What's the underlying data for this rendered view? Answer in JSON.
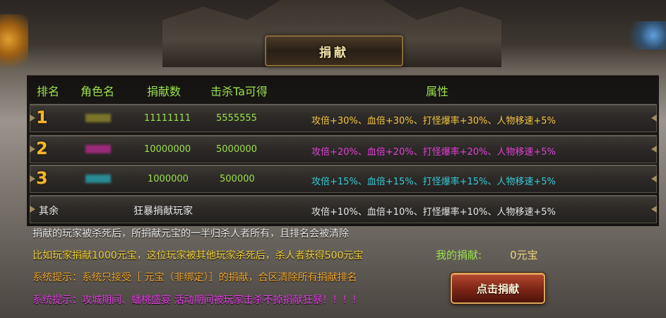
{
  "title": "捐献",
  "colors": {
    "header_green": "#9be04c",
    "rank1_attr": "#f2c340",
    "rank2_attr": "#e43fd6",
    "rank3_attr": "#36c9d6",
    "other_attr": "#e6e6e6",
    "rank1_name_blur": "#7a7428",
    "rank2_name_blur": "#9c2a7a",
    "rank3_name_blur": "#2a8a94"
  },
  "table": {
    "headers": {
      "rank": "排名",
      "role_name": "角色名",
      "donation": "捐献数",
      "kill_reward": "击杀Ta可得",
      "attributes": "属性"
    },
    "rows": [
      {
        "rank": "1",
        "donation": "11111111",
        "kill_reward": "5555555",
        "attributes": "攻倍+30%、血倍+30%、打怪爆率+30%、人物移速+5%"
      },
      {
        "rank": "2",
        "donation": "10000000",
        "kill_reward": "5000000",
        "attributes": "攻倍+20%、血倍+20%、打怪爆率+20%、人物移速+5%"
      },
      {
        "rank": "3",
        "donation": "1000000",
        "kill_reward": "500000",
        "attributes": "攻倍+15%、血倍+15%、打怪爆率+15%、人物移速+5%"
      }
    ],
    "other": {
      "rank": "其余",
      "name": "狂暴捐献玩家",
      "attributes": "攻倍+10%、血倍+10%、打怪爆率+10%、人物移速+5%"
    }
  },
  "info": {
    "line1": "捐献的玩家被杀死后，所捐献元宝的一半归杀人者所有，且排名会被清除",
    "line2": "比如玩家捐献1000元宝，这位玩家被其他玩家杀死后，杀人者获得500元宝",
    "line3": "系统提示：系统只接受［ 元宝（非绑定）］的捐献，合区清除所有捐献排名",
    "line4": "系统提示：攻城期间、蟠桃盛宴 活动期间被玩家击杀不掉捐献狂暴！！！！",
    "line1_color": "#e8e8e8",
    "line2_color": "#f2d23a",
    "line3_color": "#f0a830",
    "line4_color": "#e040e0"
  },
  "my_donation": {
    "label": "我的捐献:",
    "value": "0元宝"
  },
  "donate_button": "点击捐献"
}
